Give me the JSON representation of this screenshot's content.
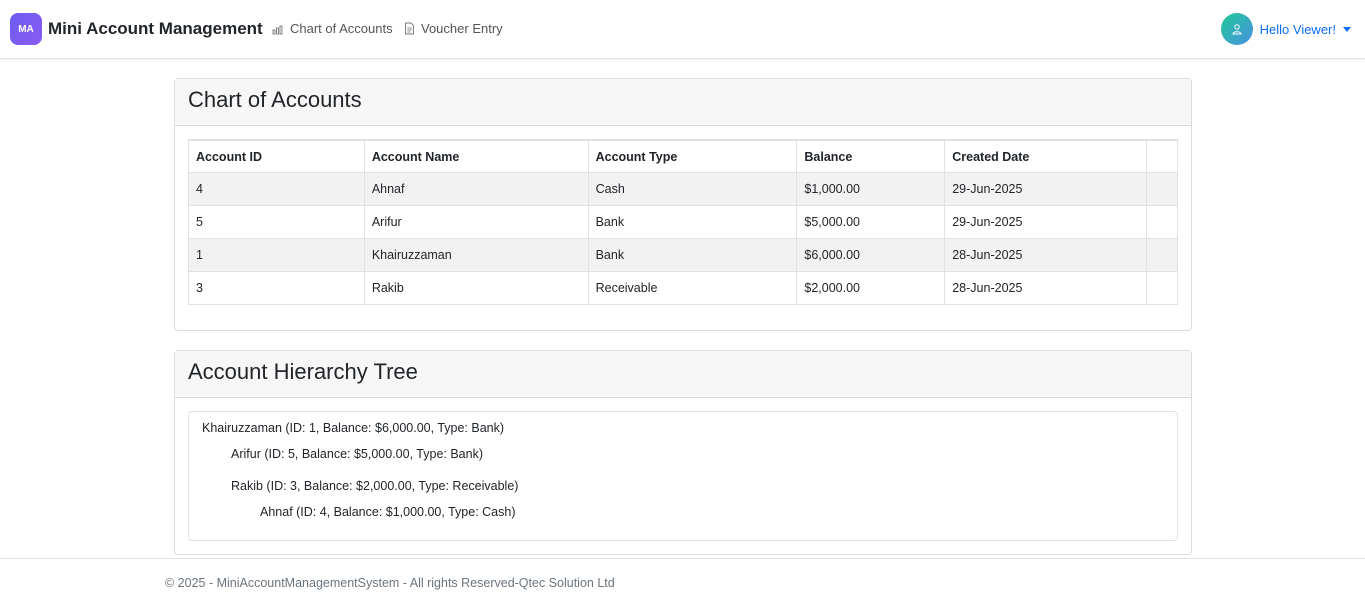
{
  "app": {
    "logo_text": "MA",
    "title": "Mini Account Management"
  },
  "nav": {
    "chart_of_accounts": "Chart of Accounts",
    "voucher_entry": "Voucher Entry"
  },
  "user": {
    "greeting": "Hello Viewer!"
  },
  "coa_card": {
    "title": "Chart of Accounts",
    "columns": [
      "Account ID",
      "Account Name",
      "Account Type",
      "Balance",
      "Created Date",
      ""
    ],
    "rows": [
      {
        "id": "4",
        "name": "Ahnaf",
        "type": "Cash",
        "balance": "$1,000.00",
        "date": "29-Jun-2025"
      },
      {
        "id": "5",
        "name": "Arifur",
        "type": "Bank",
        "balance": "$5,000.00",
        "date": "29-Jun-2025"
      },
      {
        "id": "1",
        "name": "Khairuzzaman",
        "type": "Bank",
        "balance": "$6,000.00",
        "date": "28-Jun-2025"
      },
      {
        "id": "3",
        "name": "Rakib",
        "type": "Receivable",
        "balance": "$2,000.00",
        "date": "28-Jun-2025"
      }
    ]
  },
  "tree_card": {
    "title": "Account Hierarchy Tree",
    "items": [
      "Khairuzzaman (ID: 1, Balance: $6,000.00, Type: Bank)",
      "Arifur (ID: 5, Balance: $5,000.00, Type: Bank)",
      "Rakib (ID: 3, Balance: $2,000.00, Type: Receivable)",
      "Ahnaf (ID: 4, Balance: $1,000.00, Type: Cash)"
    ]
  },
  "footer": {
    "text": "© 2025 - MiniAccountManagementSystem - All rights Reserved-Qtec Solution Ltd"
  },
  "colors": {
    "brand": "#7c5cf5",
    "link": "#0d6efd",
    "striped_row": "#f2f2f2"
  }
}
